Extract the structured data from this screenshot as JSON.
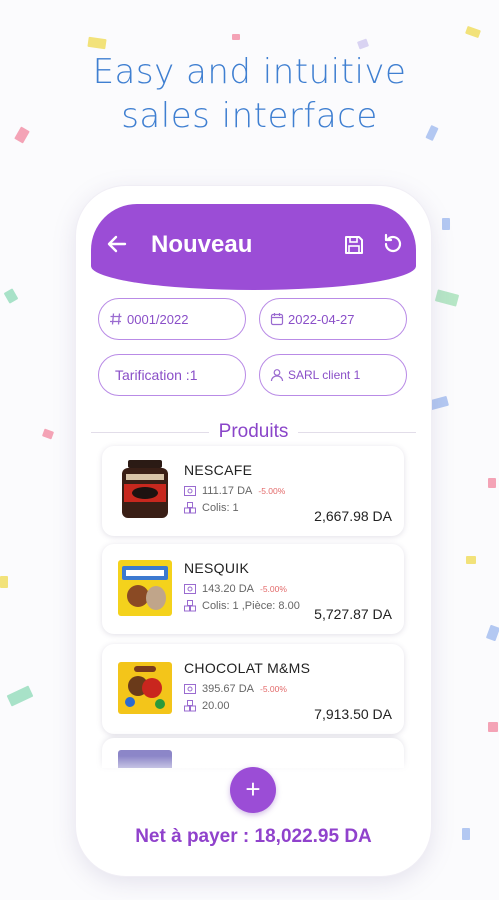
{
  "headline": {
    "line1": "Easy and intuitive",
    "line2": "sales interface"
  },
  "appbar": {
    "title": "Nouveau",
    "back_icon": "arrow-left-icon",
    "save_icon": "floppy-disk-icon",
    "reset_icon": "refresh-icon"
  },
  "form": {
    "number": "0001/2022",
    "date": "2022-04-27",
    "tarification": "Tarification :1",
    "client": "SARL client 1"
  },
  "section_title": "Produits",
  "products": [
    {
      "name": "NESCAFE",
      "price": "111.17 DA",
      "discount": "-5.00%",
      "qty": "Colis: 1",
      "total": "2,667.98 DA"
    },
    {
      "name": "NESQUIK",
      "price": "143.20 DA",
      "discount": "-5.00%",
      "qty": "Colis: 1 ,Pièce: 8.00",
      "total": "5,727.87 DA"
    },
    {
      "name": "CHOCOLAT M&MS",
      "price": "395.67 DA",
      "discount": "-5.00%",
      "qty": "20.00",
      "total": "7,913.50 DA"
    }
  ],
  "fab_label": "+",
  "net_label": "Net à payer : 18,022.95 DA",
  "colors": {
    "accent": "#9b4dd6",
    "headline": "#3f7fd1",
    "discount": "#e36a6a"
  }
}
